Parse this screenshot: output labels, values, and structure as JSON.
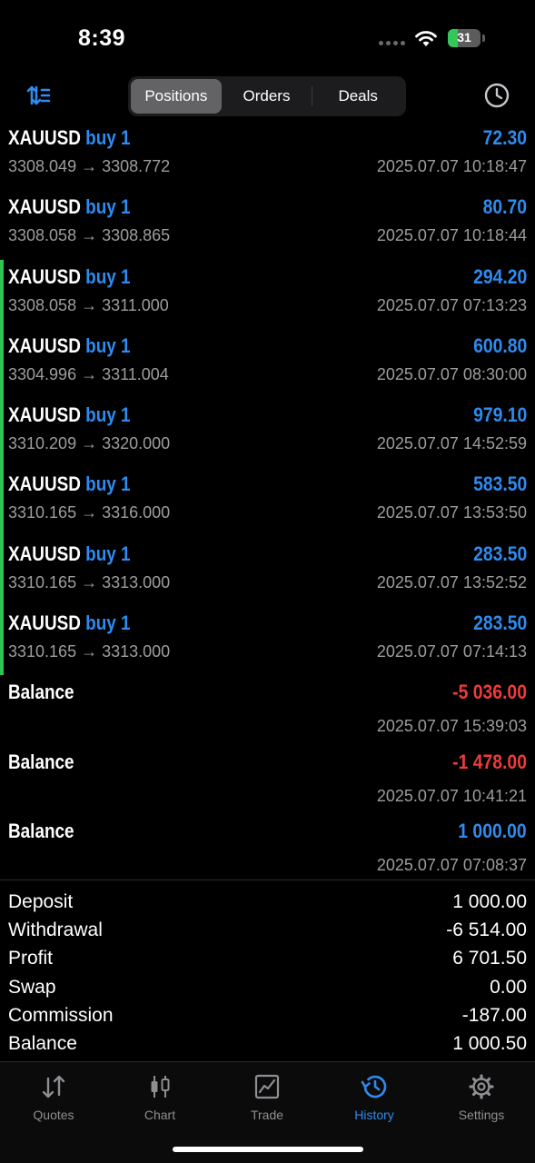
{
  "status": {
    "time": "8:39",
    "battery": "31",
    "battery_level": 0.31
  },
  "header": {
    "tabs": [
      {
        "label": "Positions",
        "active": true
      },
      {
        "label": "Orders",
        "active": false
      },
      {
        "label": "Deals",
        "active": false
      }
    ]
  },
  "rows": [
    {
      "symbol": "XAUUSD",
      "side": "buy 1",
      "profit": "72.30",
      "prices": "3308.049 → 3308.772",
      "time": "2025.07.07 10:18:47",
      "marker": false
    },
    {
      "symbol": "XAUUSD",
      "side": "buy 1",
      "profit": "80.70",
      "prices": "3308.058 → 3308.865",
      "time": "2025.07.07 10:18:44",
      "marker": false
    },
    {
      "symbol": "XAUUSD",
      "side": "buy 1",
      "profit": "294.20",
      "prices": "3308.058 → 3311.000",
      "time": "2025.07.07 07:13:23",
      "marker": true
    },
    {
      "symbol": "XAUUSD",
      "side": "buy 1",
      "profit": "600.80",
      "prices": "3304.996 → 3311.004",
      "time": "2025.07.07 08:30:00",
      "marker": true
    },
    {
      "symbol": "XAUUSD",
      "side": "buy 1",
      "profit": "979.10",
      "prices": "3310.209 → 3320.000",
      "time": "2025.07.07 14:52:59",
      "marker": true
    },
    {
      "symbol": "XAUUSD",
      "side": "buy 1",
      "profit": "583.50",
      "prices": "3310.165 → 3316.000",
      "time": "2025.07.07 13:53:50",
      "marker": true
    },
    {
      "symbol": "XAUUSD",
      "side": "buy 1",
      "profit": "283.50",
      "prices": "3310.165 → 3313.000",
      "time": "2025.07.07 13:52:52",
      "marker": true
    },
    {
      "symbol": "XAUUSD",
      "side": "buy 1",
      "profit": "283.50",
      "prices": "3310.165 → 3313.000",
      "time": "2025.07.07 07:14:13",
      "marker": true
    }
  ],
  "balances": [
    {
      "label": "Balance",
      "amount": "-5 036.00",
      "time": "2025.07.07 15:39:03",
      "negative": true
    },
    {
      "label": "Balance",
      "amount": "-1 478.00",
      "time": "2025.07.07 10:41:21",
      "negative": true
    },
    {
      "label": "Balance",
      "amount": "1 000.00",
      "time": "2025.07.07 07:08:37",
      "negative": false
    }
  ],
  "summary": {
    "deposit_label": "Deposit",
    "deposit": "1 000.00",
    "withdrawal_label": "Withdrawal",
    "withdrawal": "-6 514.00",
    "profit_label": "Profit",
    "profit": "6 701.50",
    "swap_label": "Swap",
    "swap": "0.00",
    "commission_label": "Commission",
    "commission": "-187.00",
    "balance_label": "Balance",
    "balance": "1 000.50"
  },
  "tabbar": {
    "quotes": "Quotes",
    "chart": "Chart",
    "trade": "Trade",
    "history": "History",
    "settings": "Settings",
    "active": "history"
  },
  "colors": {
    "accent": "#2e8bf0",
    "negative": "#ee3b3b",
    "marker": "#30c552"
  },
  "icons": [
    "sort-icon",
    "clock-history-icon",
    "quotes-arrows-icon",
    "candlestick-chart-icon",
    "trade-line-chart-icon",
    "history-icon",
    "gear-icon",
    "wifi-icon",
    "battery-icon"
  ]
}
